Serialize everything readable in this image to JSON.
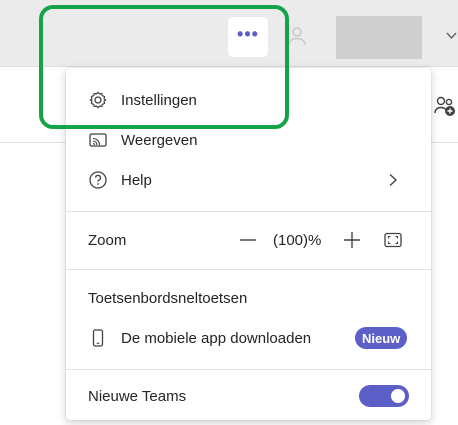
{
  "toolbar": {
    "more_label": "•••"
  },
  "menu": {
    "settings_label": "Instellingen",
    "view_label": "Weergeven",
    "help_label": "Help",
    "zoom_label": "Zoom",
    "zoom_value": "(100)%",
    "zoom_minus_label": "—",
    "zoom_plus_label": "+",
    "shortcuts_label": "Toetsenbordsneltoetsen",
    "mobile_label": "De mobiele app downloaden",
    "mobile_badge": "Nieuw",
    "new_teams_label": "Nieuwe Teams",
    "new_teams_enabled": true
  },
  "colors": {
    "accent": "#5b5fc7",
    "highlight": "#15a34a"
  },
  "icons": {
    "settings": "gear-icon",
    "view": "cast-icon",
    "help": "help-circle-icon",
    "mobile": "phone-icon",
    "more": "more-horizontal-icon"
  }
}
